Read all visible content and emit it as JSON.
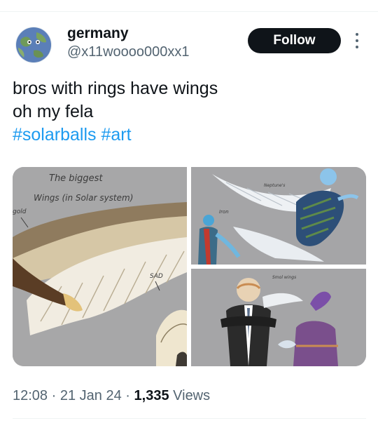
{
  "user": {
    "name": "germany",
    "handle": "@x11woooo000xx1"
  },
  "actions": {
    "follow_label": "Follow"
  },
  "tweet": {
    "lines": [
      "bros with rings have wings",
      "oh my fela"
    ],
    "hashtags": [
      "#solarballs",
      "#art"
    ]
  },
  "media": {
    "left_panel": {
      "title_line1": "The biggest",
      "title_line2": "Wings (in Solar system)",
      "label_gold": "gold",
      "label_sad": "SAD"
    },
    "top_right_panel": {
      "label_top": "Neptune's",
      "label_iron": "Iron"
    },
    "bottom_right_panel": {
      "label_small_wings": "Smol wings"
    }
  },
  "meta": {
    "time": "12:08",
    "separator": "·",
    "date": "21 Jan 24",
    "views_count": "1,335",
    "views_label": "Views"
  },
  "colors": {
    "accent": "#1d9bf0",
    "text_primary": "#0f1419",
    "text_secondary": "#536471",
    "follow_bg": "#0f1419",
    "divider": "#eff3f4"
  }
}
